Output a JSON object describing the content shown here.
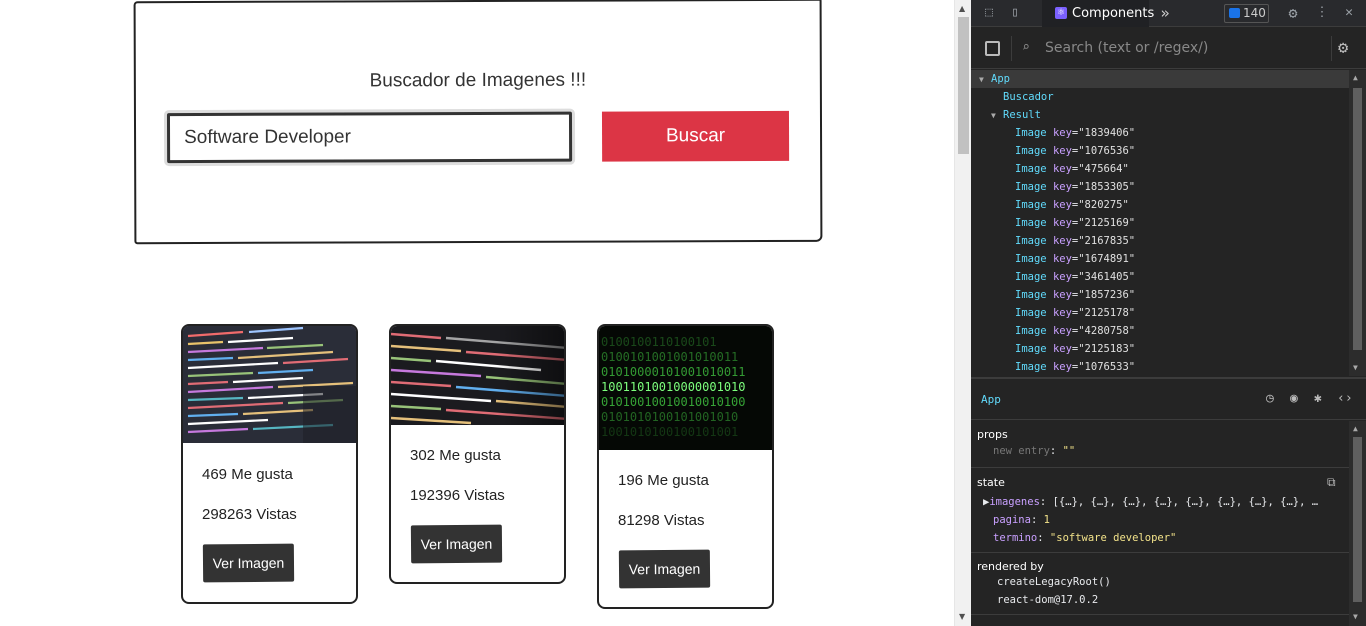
{
  "search": {
    "title": "Buscador de Imagenes !!!",
    "input_value": "Software Developer",
    "button_label": "Buscar"
  },
  "cards": [
    {
      "likes": "469 Me gusta",
      "views": "298263 Vistas",
      "button": "Ver Imagen"
    },
    {
      "likes": "302 Me gusta",
      "views": "192396 Vistas",
      "button": "Ver Imagen"
    },
    {
      "likes": "196 Me gusta",
      "views": "81298 Vistas",
      "button": "Ver Imagen"
    }
  ],
  "devtools": {
    "tab_label": "Components",
    "badge_count": "140",
    "search_placeholder": "Search (text or /regex/)",
    "tree": {
      "app": "App",
      "buscador": "Buscador",
      "result": "Result",
      "image_tag": "Image",
      "key_attr": "key",
      "keys": [
        "\"1839406\"",
        "\"1076536\"",
        "\"475664\"",
        "\"1853305\"",
        "\"820275\"",
        "\"2125169\"",
        "\"2167835\"",
        "\"1674891\"",
        "\"3461405\"",
        "\"1857236\"",
        "\"2125178\"",
        "\"4280758\"",
        "\"2125183\"",
        "\"1076533\""
      ]
    },
    "selected_component": "App",
    "props": {
      "title": "props",
      "new_entry_key": "new entry",
      "new_entry_value": "\"\""
    },
    "state": {
      "title": "state",
      "imagenes_key": "imagenes",
      "imagenes_value": "[{…}, {…}, {…}, {…}, {…}, {…}, {…}, {…}, …",
      "pagina_key": "pagina",
      "pagina_value": "1",
      "termino_key": "termino",
      "termino_value": "\"software developer\""
    },
    "rendered_by": {
      "title": "rendered by",
      "items": [
        "createLegacyRoot()",
        "react-dom@17.0.2"
      ]
    }
  },
  "colors": {
    "accent_button": "#dc3545",
    "dark_button": "#333333",
    "react_blue": "#61dafb",
    "devtools_bg": "#242424"
  }
}
